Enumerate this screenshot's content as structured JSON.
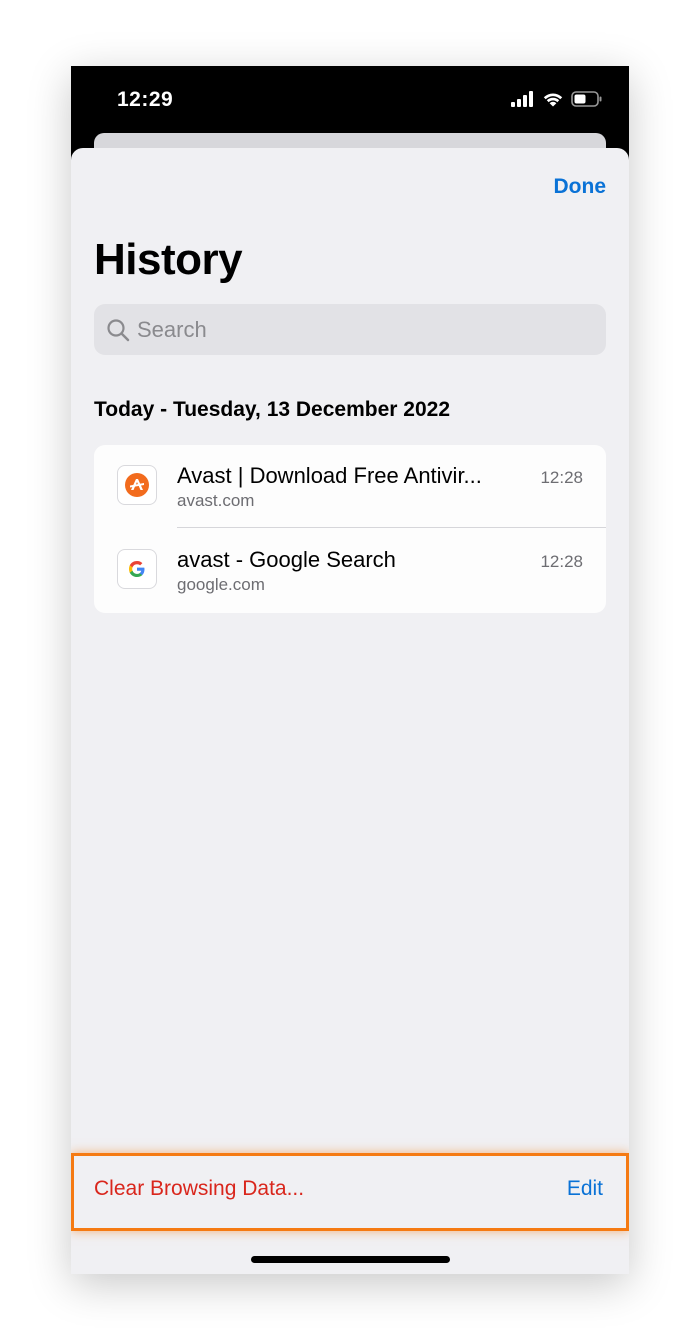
{
  "status_bar": {
    "time": "12:29",
    "icons": [
      "cellular-signal-icon",
      "wifi-icon",
      "battery-icon"
    ]
  },
  "header": {
    "done_label": "Done",
    "title": "History"
  },
  "search": {
    "placeholder": "Search",
    "value": ""
  },
  "history": {
    "section_header": "Today - Tuesday, 13 December 2022",
    "items": [
      {
        "title": "Avast | Download Free Antivir...",
        "domain": "avast.com",
        "time": "12:28",
        "favicon": "avast-favicon-icon"
      },
      {
        "title": "avast - Google Search",
        "domain": "google.com",
        "time": "12:28",
        "favicon": "google-favicon-icon"
      }
    ]
  },
  "toolbar": {
    "clear_label": "Clear Browsing Data...",
    "edit_label": "Edit"
  },
  "colors": {
    "accent_blue": "#0a72d6",
    "destructive_red": "#d9261c",
    "highlight_orange": "#f57a12",
    "sheet_background": "#f0f0f3",
    "avast_orange": "#f26b1d"
  }
}
